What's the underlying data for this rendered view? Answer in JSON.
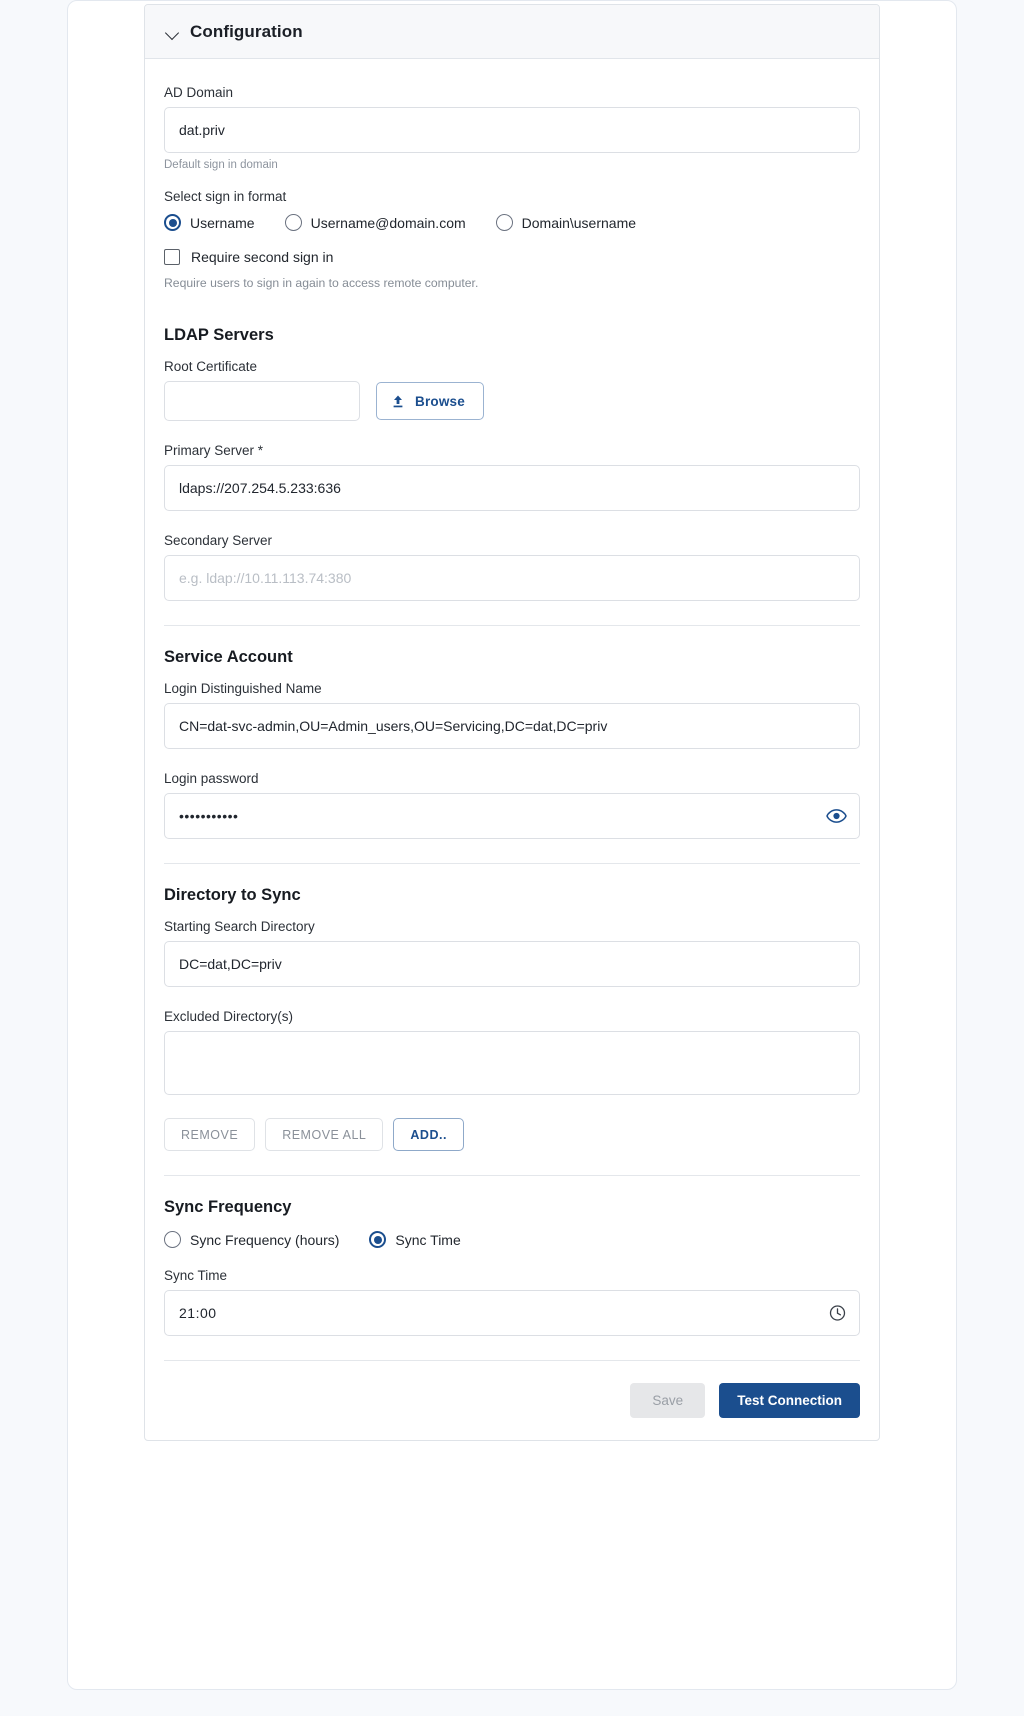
{
  "panel": {
    "title": "Configuration",
    "collapse_icon": "chevron-down-icon"
  },
  "ad_domain": {
    "label": "AD Domain",
    "value": "dat.priv",
    "hint": "Default sign in domain"
  },
  "sign_in_format": {
    "label": "Select sign in format",
    "options": [
      {
        "label": "Username",
        "selected": true
      },
      {
        "label": "Username@domain.com",
        "selected": false
      },
      {
        "label": "Domain\\username",
        "selected": false
      }
    ]
  },
  "second_sign_in": {
    "label": "Require second sign in",
    "checked": false,
    "hint": "Require users to sign in again to access remote computer."
  },
  "ldap_servers": {
    "title": "LDAP Servers",
    "root_certificate": {
      "label": "Root Certificate",
      "value": "",
      "browse_label": "Browse",
      "browse_icon": "upload-icon"
    },
    "primary_server": {
      "label": "Primary Server *",
      "value": "ldaps://207.254.5.233:636"
    },
    "secondary_server": {
      "label": "Secondary Server",
      "value": "",
      "placeholder": "e.g. ldap://10.11.113.74:380"
    }
  },
  "service_account": {
    "title": "Service Account",
    "login_dn": {
      "label": "Login Distinguished Name",
      "value": "CN=dat-svc-admin,OU=Admin_users,OU=Servicing,DC=dat,DC=priv"
    },
    "login_password": {
      "label": "Login password",
      "value": "•••••••••••",
      "reveal_icon": "eye-icon"
    }
  },
  "directory_to_sync": {
    "title": "Directory to Sync",
    "starting_search_directory": {
      "label": "Starting Search Directory",
      "value": "DC=dat,DC=priv"
    },
    "excluded_directories": {
      "label": "Excluded Directory(s)",
      "value": ""
    },
    "buttons": {
      "remove": "REMOVE",
      "remove_all": "REMOVE ALL",
      "add": "ADD.."
    }
  },
  "sync_frequency": {
    "title": "Sync Frequency",
    "options": [
      {
        "label": "Sync Frequency (hours)",
        "selected": false
      },
      {
        "label": "Sync Time",
        "selected": true
      }
    ],
    "sync_time": {
      "label": "Sync Time",
      "value": "21:00",
      "picker_icon": "clock-icon"
    }
  },
  "footer": {
    "save_label": "Save",
    "test_connection_label": "Test Connection"
  },
  "colors": {
    "accent": "#1b4e8e",
    "page_bg": "#f7f9fc",
    "header_bg": "#f7f8fa",
    "border": "#dcdfe4"
  }
}
